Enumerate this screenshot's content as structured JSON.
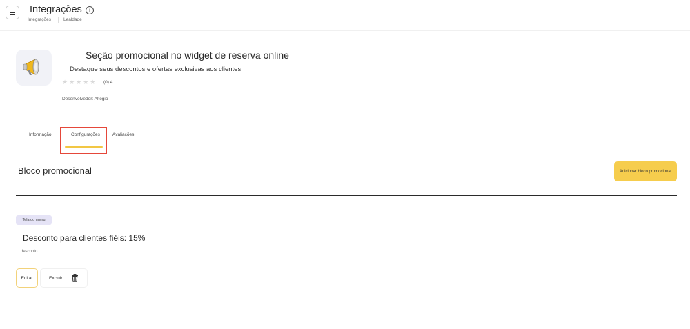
{
  "header": {
    "title": "Integrações",
    "info_icon": "info-icon",
    "breadcrumb": [
      "Integrações",
      "Lealdade"
    ]
  },
  "app": {
    "icon": "megaphone-icon",
    "title": "Seção promocional no widget de reserva online",
    "subtitle": "Destaque seus descontos e ofertas exclusivas aos clientes",
    "stars": "★★★★★",
    "rating_text": "(0) 4",
    "developer": "Desenvolvedor: Altegio"
  },
  "tabs": [
    {
      "label": "Informação"
    },
    {
      "label": "Configurações",
      "active": true
    },
    {
      "label": "Avaliações"
    }
  ],
  "section": {
    "title": "Bloco promocional",
    "add_button": "Adicionar bloco promocional"
  },
  "promo": {
    "badge": "Tela do menu",
    "title": "Desconto para clientes fiéis: 15%",
    "type": "desconto",
    "edit_button": "Editar",
    "delete_button": "Excluir",
    "delete_icon": "trash-icon"
  },
  "colors": {
    "accent": "#f6cd4d",
    "highlight_box": "#e5483a",
    "badge_bg": "#e5e3f6"
  }
}
